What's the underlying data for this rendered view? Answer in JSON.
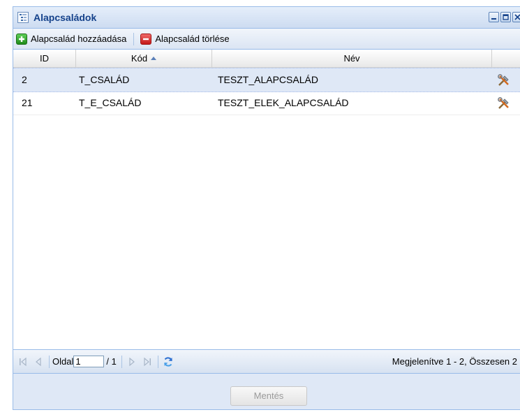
{
  "window": {
    "title": "Alapcsaládok",
    "icon": "tree-list-icon",
    "tools": [
      "minimize-icon",
      "maximize-icon",
      "close-icon"
    ]
  },
  "toolbar": {
    "add_label": "Alapcsalád hozzáadása",
    "delete_label": "Alapcsalád törlése"
  },
  "grid": {
    "columns": [
      "ID",
      "Kód",
      "Név",
      ""
    ],
    "sort": {
      "column": "Kód",
      "direction": "asc"
    },
    "rows": [
      {
        "id": "2",
        "code": "T_CSALÁD",
        "name": "TESZT_ALAPCSALÁD",
        "selected": true,
        "action_icon": "edit-tools-icon"
      },
      {
        "id": "21",
        "code": "T_E_CSALÁD",
        "name": "TESZT_ELEK_ALAPCSALÁD",
        "selected": false,
        "action_icon": "edit-tools-icon"
      }
    ]
  },
  "pager": {
    "page_label": "Oldal",
    "page_value": "1",
    "of_label": "/ 1",
    "info": "Megjelenítve 1 - 2, Összesen 2"
  },
  "footer": {
    "save_label": "Mentés"
  },
  "colors": {
    "title_text": "#15428b",
    "panel_bg": "#dfe8f6",
    "border": "#99bbe8"
  }
}
